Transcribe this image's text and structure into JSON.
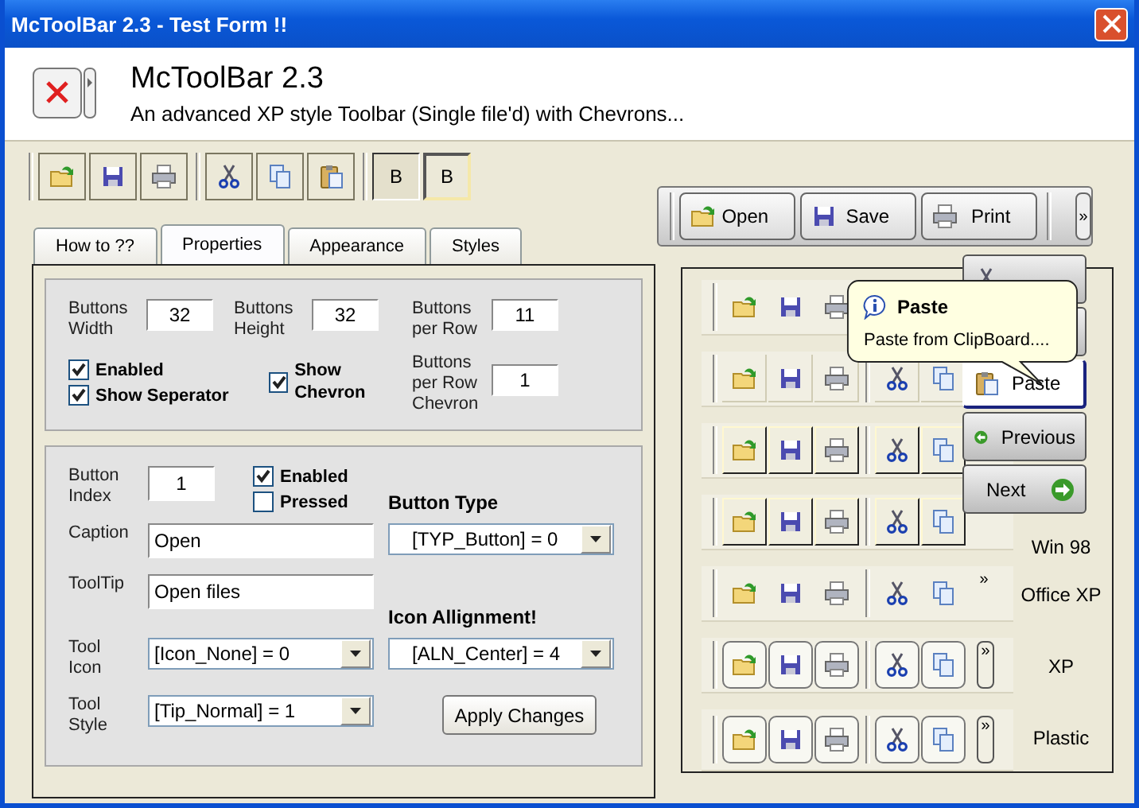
{
  "window": {
    "title": "McToolBar 2.3 - Test Form !!"
  },
  "header": {
    "title": "McToolBar 2.3",
    "subtitle": "An advanced XP style Toolbar (Single file'd) with Chevrons..."
  },
  "toolbar": [
    {
      "kind": "separator"
    },
    {
      "kind": "open"
    },
    {
      "kind": "save"
    },
    {
      "kind": "print"
    },
    {
      "kind": "separator"
    },
    {
      "kind": "cut"
    },
    {
      "kind": "copy"
    },
    {
      "kind": "paste"
    },
    {
      "kind": "separator"
    },
    {
      "kind": "text",
      "label": "B",
      "pressed": true
    },
    {
      "kind": "text",
      "label": "B",
      "pressed": false
    }
  ],
  "floating_toolbar": {
    "buttons": [
      {
        "kind": "open",
        "label": "Open"
      },
      {
        "kind": "save",
        "label": "Save"
      },
      {
        "kind": "print",
        "label": "Print"
      }
    ],
    "chevron": "»"
  },
  "tabs": [
    {
      "label": "How to ??",
      "selected": false
    },
    {
      "label": "Properties",
      "selected": true
    },
    {
      "label": "Appearance",
      "selected": false
    },
    {
      "label": "Styles",
      "selected": false
    }
  ],
  "toolbar_settings": {
    "fields": [
      {
        "label": "Buttons Width",
        "value": "32"
      },
      {
        "label": "Buttons Height",
        "value": "32"
      },
      {
        "label": "Buttons per Row",
        "value": "11"
      }
    ],
    "checkboxes": [
      {
        "label": "Enabled",
        "checked": true
      },
      {
        "label": "Show Seperator",
        "checked": true
      }
    ],
    "show_chevron": {
      "label": "Show Chevron",
      "checked": true
    },
    "chevron_field": {
      "label": "Buttons per Row Chevron",
      "value": "1"
    }
  },
  "button_settings": {
    "index": {
      "label": "Button Index",
      "value": "1"
    },
    "checkboxes": [
      {
        "label": "Enabled",
        "checked": true
      },
      {
        "label": "Pressed",
        "checked": false
      }
    ],
    "caption": {
      "label": "Caption",
      "value": "Open"
    },
    "tooltip": {
      "label": "ToolTip",
      "value": "Open files"
    },
    "tool_icon": {
      "label": "Tool Icon",
      "value": "[Icon_None] = 0"
    },
    "tool_style": {
      "label": "Tool Style",
      "value": "[Tip_Normal] = 1"
    },
    "button_type": {
      "heading": "Button Type",
      "value": "[TYP_Button] = 0"
    },
    "icon_alignment": {
      "heading": "Icon Allignment!",
      "value": "[ALN_Center] = 4"
    },
    "apply_button": "Apply Changes"
  },
  "style_previews": [
    {
      "kind": "flat",
      "tools": [
        {
          "kind": "open"
        },
        {
          "kind": "save"
        },
        {
          "kind": "print"
        }
      ]
    },
    {
      "kind": "etched",
      "tools": [
        {
          "kind": "open"
        },
        {
          "kind": "save"
        },
        {
          "kind": "print"
        },
        {
          "kind": "separator"
        },
        {
          "kind": "cut"
        },
        {
          "kind": "copy"
        }
      ]
    },
    {
      "kind": "boxed",
      "tools": [
        {
          "kind": "open"
        },
        {
          "kind": "save"
        },
        {
          "kind": "print"
        },
        {
          "kind": "separator"
        },
        {
          "kind": "cut"
        },
        {
          "kind": "copy"
        }
      ]
    },
    {
      "kind": "win98",
      "label": "Win 98",
      "tools": [
        {
          "kind": "open"
        },
        {
          "kind": "save"
        },
        {
          "kind": "print"
        },
        {
          "kind": "separator"
        },
        {
          "kind": "cut"
        },
        {
          "kind": "copy"
        }
      ]
    },
    {
      "kind": "officexp",
      "label": "Office XP",
      "chevron": "»",
      "tools": [
        {
          "kind": "open"
        },
        {
          "kind": "save"
        },
        {
          "kind": "print"
        },
        {
          "kind": "separator"
        },
        {
          "kind": "cut"
        },
        {
          "kind": "copy"
        }
      ]
    },
    {
      "kind": "xp",
      "label": "XP",
      "chevron": "»",
      "tools": [
        {
          "kind": "open"
        },
        {
          "kind": "save"
        },
        {
          "kind": "print"
        },
        {
          "kind": "separator"
        },
        {
          "kind": "cut"
        },
        {
          "kind": "copy"
        }
      ]
    },
    {
      "kind": "plastic",
      "label": "Plastic",
      "chevron": "»",
      "tools": [
        {
          "kind": "open"
        },
        {
          "kind": "save"
        },
        {
          "kind": "print"
        },
        {
          "kind": "separator"
        },
        {
          "kind": "cut"
        },
        {
          "kind": "copy"
        }
      ]
    }
  ],
  "popup_menu": [
    {
      "kind": "cut",
      "selected": false
    },
    {
      "kind": "covered"
    },
    {
      "kind": "paste",
      "label": "Paste",
      "selected": true
    },
    {
      "kind": "previous",
      "label": "Previous",
      "selected": false
    },
    {
      "kind": "next",
      "label": "Next",
      "selected": false
    }
  ],
  "balloon_tip": {
    "title": "Paste",
    "text": "Paste from ClipBoard...."
  }
}
